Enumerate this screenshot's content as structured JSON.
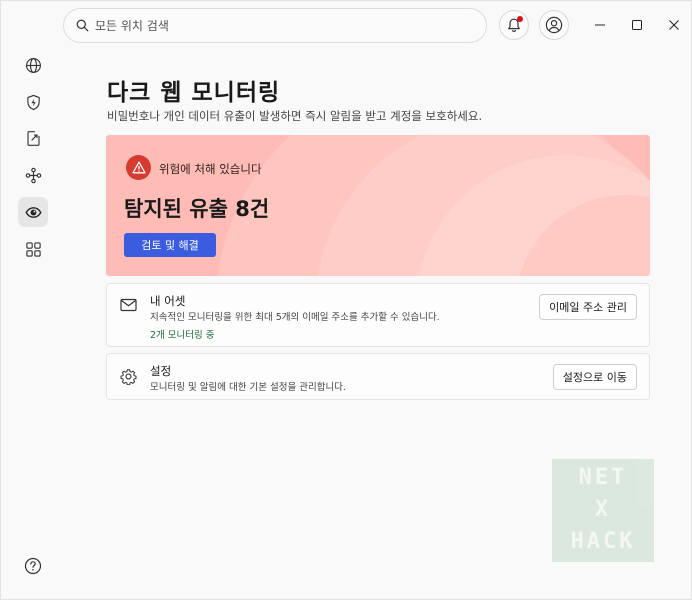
{
  "search": {
    "placeholder": "모든 위치 검색"
  },
  "sidebar": {
    "items": [
      {
        "name": "globe-icon"
      },
      {
        "name": "shield-bolt-icon"
      },
      {
        "name": "file-export-icon"
      },
      {
        "name": "network-nodes-icon"
      },
      {
        "name": "eye-icon",
        "active": true
      },
      {
        "name": "apps-grid-icon"
      }
    ],
    "help_icon": "help-icon"
  },
  "header": {
    "title": "다크 웹 모니터링",
    "subtitle": "비밀번호나 개인 데이터 유출이 발생하면 즉시 알림을 받고 계정을 보호하세요."
  },
  "alert": {
    "warning_text": "위험에 처해 있습니다",
    "count_text": "탐지된 유출 8건",
    "button_label": "검토 및 해결",
    "background_color": "#ffbcb6",
    "button_color": "#3c5ce0"
  },
  "assets_card": {
    "title": "내 어셋",
    "description": "지속적인 모니터링을 위한 최대 5개의 이메일 주소를 추가할 수 있습니다.",
    "status": "2개 모니터링 중",
    "button_label": "이메일 주소 관리"
  },
  "settings_card": {
    "title": "설정",
    "description": "모니터링 및 알림에 대한 기본 설정을 관리합니다.",
    "button_label": "설정으로 이동"
  },
  "watermark": {
    "lines": [
      "NET",
      "X",
      "HACK"
    ]
  }
}
